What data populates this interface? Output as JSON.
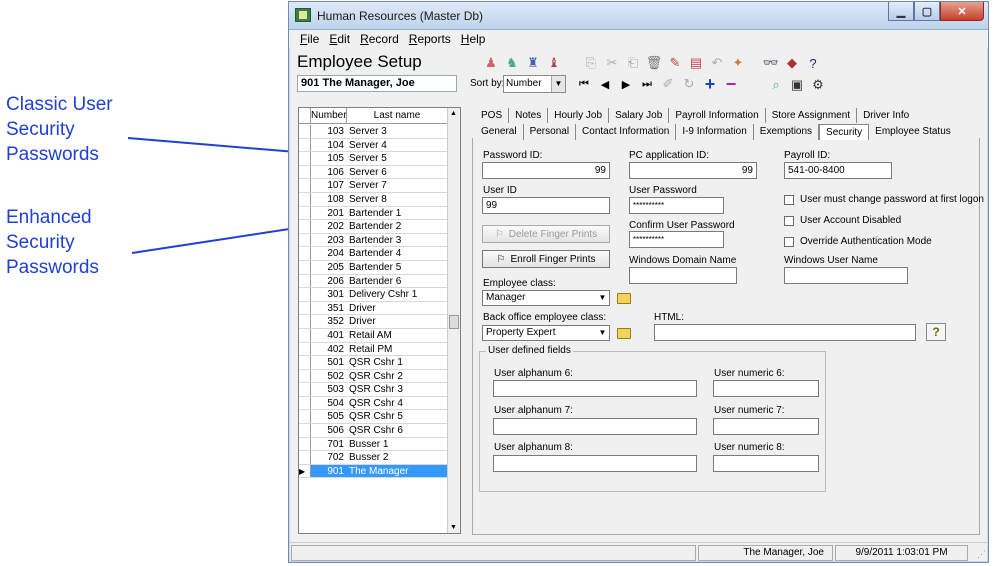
{
  "annotations": [
    {
      "text": "Classic User Security Passwords"
    },
    {
      "text": "Enhanced Security Passwords"
    }
  ],
  "window": {
    "title": "Human Resources (Master Db)",
    "menus": [
      "File",
      "Edit",
      "Record",
      "Reports",
      "Help"
    ]
  },
  "header": {
    "title": "Employee Setup",
    "current_record": "901  The Manager, Joe",
    "sort_label": "Sort by:",
    "sort_value": "Number"
  },
  "list": {
    "columns": [
      "Number",
      "Last name"
    ],
    "rows": [
      {
        "num": "103",
        "name": "Server 3"
      },
      {
        "num": "104",
        "name": "Server 4"
      },
      {
        "num": "105",
        "name": "Server 5"
      },
      {
        "num": "106",
        "name": "Server 6"
      },
      {
        "num": "107",
        "name": "Server 7"
      },
      {
        "num": "108",
        "name": "Server 8"
      },
      {
        "num": "201",
        "name": "Bartender 1"
      },
      {
        "num": "202",
        "name": "Bartender 2"
      },
      {
        "num": "203",
        "name": "Bartender 3"
      },
      {
        "num": "204",
        "name": "Bartender 4"
      },
      {
        "num": "205",
        "name": "Bartender 5"
      },
      {
        "num": "206",
        "name": "Bartender 6"
      },
      {
        "num": "301",
        "name": "Delivery Cshr 1"
      },
      {
        "num": "351",
        "name": "Driver"
      },
      {
        "num": "352",
        "name": "Driver"
      },
      {
        "num": "401",
        "name": "Retail AM"
      },
      {
        "num": "402",
        "name": "Retail PM"
      },
      {
        "num": "501",
        "name": "QSR Cshr 1"
      },
      {
        "num": "502",
        "name": "QSR Cshr 2"
      },
      {
        "num": "503",
        "name": "QSR Cshr 3"
      },
      {
        "num": "504",
        "name": "QSR Cshr 4"
      },
      {
        "num": "505",
        "name": "QSR Cshr 5"
      },
      {
        "num": "506",
        "name": "QSR Cshr 6"
      },
      {
        "num": "701",
        "name": "Busser 1"
      },
      {
        "num": "702",
        "name": "Busser 2"
      },
      {
        "num": "901",
        "name": "The Manager",
        "selected": true
      }
    ]
  },
  "tabs_row1": [
    "POS",
    "Notes",
    "Hourly Job",
    "Salary Job",
    "Payroll Information",
    "Store Assignment",
    "Driver Info"
  ],
  "tabs_row2": [
    "General",
    "Personal",
    "Contact Information",
    "I-9 Information",
    "Exemptions",
    "Security",
    "Employee Status"
  ],
  "active_tab": "Security",
  "security": {
    "password_id_label": "Password ID:",
    "password_id_value": "99",
    "pc_app_id_label": "PC application ID:",
    "pc_app_id_value": "99",
    "payroll_id_label": "Payroll ID:",
    "payroll_id_value": "541-00-8400",
    "user_id_label": "User ID",
    "user_id_value": "99",
    "user_password_label": "User Password",
    "user_password_value": "**********",
    "confirm_password_label": "Confirm User Password",
    "confirm_password_value": "**********",
    "must_change_label": "User must change password at first logon",
    "disabled_label": "User Account Disabled",
    "override_label": "Override Authentication Mode",
    "delete_fp_label": "Delete Finger Prints",
    "enroll_fp_label": "Enroll Finger Prints",
    "domain_label": "Windows Domain Name",
    "domain_value": "",
    "win_user_label": "Windows User Name",
    "win_user_value": "",
    "emp_class_label": "Employee class:",
    "emp_class_value": "Manager",
    "bo_class_label": "Back office employee class:",
    "bo_class_value": "Property Expert",
    "html_label": "HTML:",
    "html_value": ""
  },
  "user_defined": {
    "title": "User defined fields",
    "alpha6": "User alphanum 6:",
    "alpha7": "User alphanum 7:",
    "alpha8": "User alphanum 8:",
    "num6": "User numeric 6:",
    "num7": "User numeric 7:",
    "num8": "User numeric 8:"
  },
  "status": {
    "user": "The Manager, Joe",
    "datetime": "9/9/2011 1:03:01 PM"
  },
  "colors": {
    "annotation": "#1f3fd6",
    "selection": "#3399ff"
  }
}
